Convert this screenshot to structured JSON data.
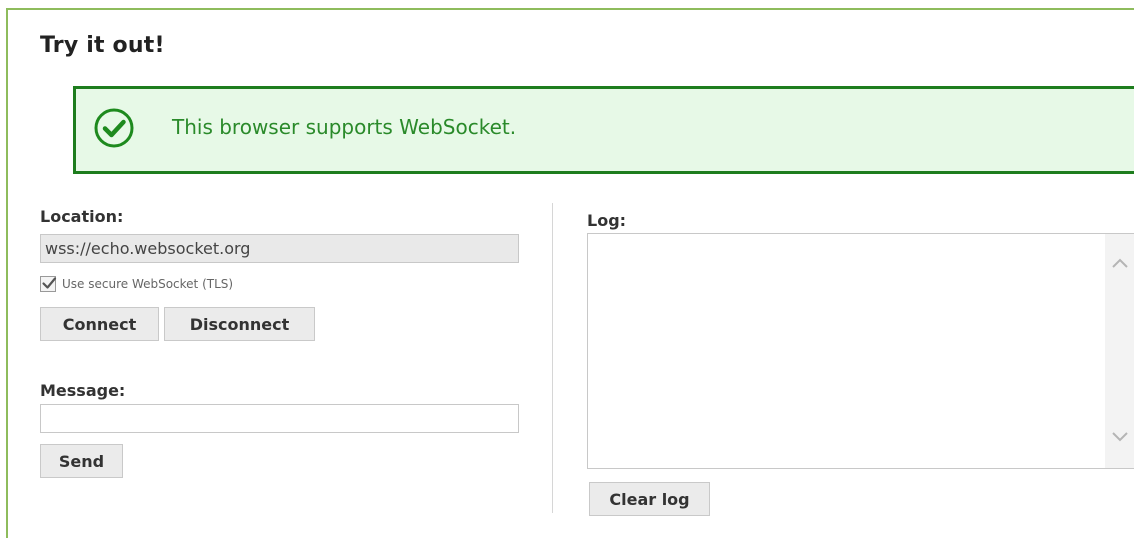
{
  "section": {
    "title": "Try it out!"
  },
  "notice": {
    "icon": "check-circle-icon",
    "text": "This browser supports WebSocket.",
    "border_color": "#1e7d1e",
    "background_color": "#e7f9e7",
    "text_color": "#2a8a2a"
  },
  "location": {
    "label": "Location:",
    "value": "wss://echo.websocket.org",
    "tls_checkbox_label": "Use secure WebSocket (TLS)",
    "tls_checked": true
  },
  "buttons": {
    "connect": "Connect",
    "disconnect": "Disconnect",
    "send": "Send",
    "clear_log": "Clear log"
  },
  "message": {
    "label": "Message:",
    "value": ""
  },
  "log": {
    "label": "Log:",
    "content": ""
  },
  "colors": {
    "frame_border": "#8ebc5c",
    "button_bg": "#ebebeb"
  }
}
